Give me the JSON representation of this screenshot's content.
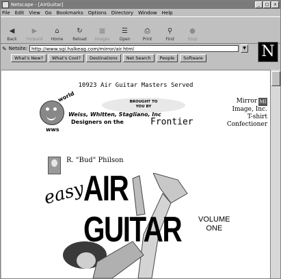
{
  "window": {
    "title": "Netscape - [AirGuitar]",
    "controls": [
      "_",
      "□",
      "x"
    ]
  },
  "menu": [
    "File",
    "Edit",
    "View",
    "Go",
    "Bookmarks",
    "Options",
    "Directory",
    "Window",
    "Help"
  ],
  "toolbar": [
    {
      "label": "Back",
      "icon": "back-arrow-icon",
      "enabled": true
    },
    {
      "label": "Forward",
      "icon": "forward-arrow-icon",
      "enabled": false
    },
    {
      "label": "Home",
      "icon": "home-icon",
      "enabled": true
    },
    {
      "label": "Reload",
      "icon": "reload-icon",
      "enabled": true
    },
    {
      "label": "Images",
      "icon": "images-icon",
      "enabled": false
    },
    {
      "label": "Open",
      "icon": "open-icon",
      "enabled": true
    },
    {
      "label": "Print",
      "icon": "print-icon",
      "enabled": true
    },
    {
      "label": "Find",
      "icon": "find-icon",
      "enabled": true
    },
    {
      "label": "Stop",
      "icon": "stop-icon",
      "enabled": false
    }
  ],
  "location": {
    "label": "Netsite:",
    "url": "http://www.sgi.halkeag.com/mirror/air.html"
  },
  "directory_buttons": [
    "What's New?",
    "What's Cool?",
    "Destinations",
    "Net Search",
    "People",
    "Software"
  ],
  "page": {
    "banner": "10923 Air Guitar Masters Served",
    "logo_top": "world",
    "logo_bottom": "wws",
    "brought_to": "BROUGHT TO",
    "brought_by": "YOU BY",
    "sponsor_names": "Weiss, Whitten, Stagliano, Inc",
    "sponsor_tagline": "Designers on the",
    "sponsor_tagline_highlight": "Frontier",
    "mirror_line1": "Mirror",
    "mirror_badge": "MI",
    "mirror_line2": "Image, Inc.",
    "mirror_line3": "T-shirt",
    "mirror_line4": "Confectioner",
    "author": "R. \"Bud\" Philson",
    "easy": "easy",
    "title": "AIR GUITAR",
    "volume_line1": "VOLUME",
    "volume_line2": "ONE"
  }
}
